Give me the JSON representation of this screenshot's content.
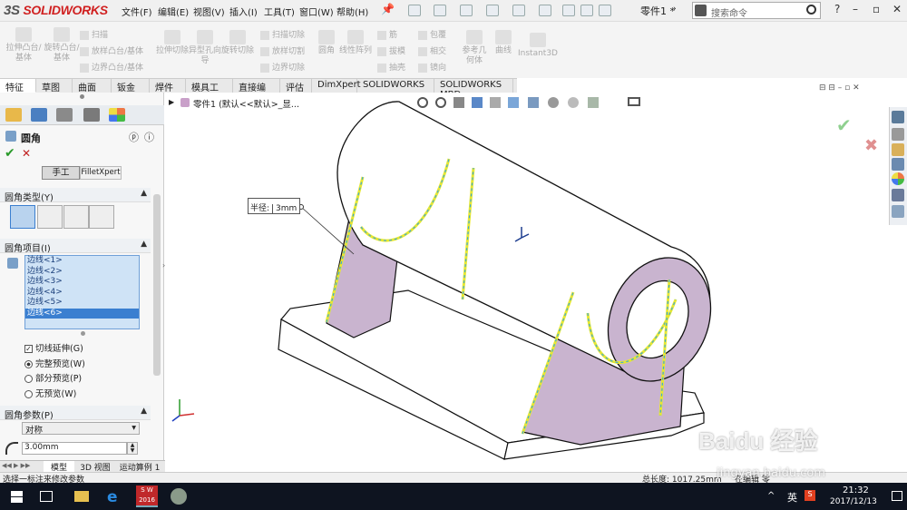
{
  "app": {
    "logo_ds": "3S",
    "logo_text": "SOLIDWORKS"
  },
  "menu": [
    "文件(F)",
    "编辑(E)",
    "视图(V)",
    "插入(I)",
    "工具(T)",
    "窗口(W)",
    "帮助(H)"
  ],
  "title": {
    "doc_name": "零件1 *"
  },
  "search": {
    "placeholder": "搜索命令"
  },
  "ribbon": {
    "big": [
      {
        "label": "拉伸凸台/基体"
      },
      {
        "label": "旋转凸台/基体"
      },
      {
        "label": "拉伸切除"
      },
      {
        "label": "异型孔向导"
      },
      {
        "label": "旋转切除"
      },
      {
        "label": "圆角"
      },
      {
        "label": "线性阵列"
      },
      {
        "label": "参考几何体"
      },
      {
        "label": "曲线"
      },
      {
        "label": "Instant3D"
      }
    ],
    "small1": [
      "扫描",
      "放样凸台/基体",
      "边界凸台/基体"
    ],
    "small2": [
      "扫描切除",
      "放样切割",
      "边界切除"
    ],
    "small3": [
      "筋",
      "拔模",
      "抽壳"
    ],
    "small4": [
      "包覆",
      "相交",
      "镜向"
    ]
  },
  "tabs": [
    "特征",
    "草图",
    "曲面",
    "钣金",
    "焊件",
    "模具工具",
    "直接编辑",
    "评估",
    "DimXpert",
    "SOLIDWORKS 插件",
    "SOLIDWORKS MBD"
  ],
  "tree": {
    "breadcrumb": "零件1 (默认<<默认>_显..."
  },
  "panel": {
    "title": "圆角",
    "mode_manual": "手工",
    "mode_fx": "FilletXpert",
    "fillet_type_header": "圆角类型(Y)",
    "items_header": "圆角项目(I)",
    "edges": [
      "边线<1>",
      "边线<2>",
      "边线<3>",
      "边线<4>",
      "边线<5>",
      "边线<6>"
    ],
    "selected_edge_index": 5,
    "tangent_prop": "切线延伸(G)",
    "preview_full": "完整预览(W)",
    "preview_partial": "部分预览(P)",
    "preview_none": "无预览(W)",
    "params_header": "圆角参数(P)",
    "symmetric": "对称",
    "radius_value": "3.00mm"
  },
  "callout": {
    "label": "半径:",
    "value": "3mm"
  },
  "bottom_tabs": [
    "模型",
    "3D 视图",
    "运动算例 1"
  ],
  "status": {
    "left": "选择一标注来修改参数",
    "right": "总长度: 1017.25mm",
    "edit": "在编辑 零"
  },
  "taskbar": {
    "ime": "英",
    "time": "21:32",
    "date": "2017/12/13",
    "sw_label": "S W 2016"
  },
  "watermark": {
    "brand": "Baidu 经验",
    "url": "jingyan.baidu.com"
  },
  "colors": {
    "accent": "#3b7fd0",
    "part_face": "#c9b4cf",
    "edge_highlight": "#e8e830",
    "preview": "#3aa7d8"
  }
}
